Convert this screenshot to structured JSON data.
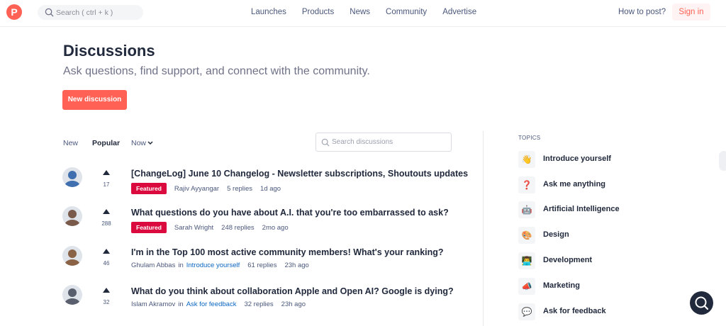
{
  "header": {
    "logo_letter": "P",
    "search_placeholder": "Search ( ctrl + k )",
    "nav": [
      "Launches",
      "Products",
      "News",
      "Community",
      "Advertise"
    ],
    "how_to_post": "How to post?",
    "sign_in": "Sign in"
  },
  "hero": {
    "title": "Discussions",
    "subtitle": "Ask questions, find support, and connect with the community.",
    "new_button": "New discussion"
  },
  "filters": {
    "new": "New",
    "popular": "Popular",
    "now": "Now",
    "search_placeholder": "Search discussions"
  },
  "discussions": [
    {
      "title": "[ChangeLog] June 10 Changelog - Newsletter subscriptions, Shoutouts updates",
      "votes": "17",
      "badge": "Featured",
      "author": "Rajiv Ayyangar",
      "topic_prefix": "",
      "topic": "",
      "replies": "5 replies",
      "time": "1d ago",
      "avatar_color": "#3f6fae"
    },
    {
      "title": "What questions do you have about A.I. that you're too embarrassed to ask?",
      "votes": "288",
      "badge": "Featured",
      "author": "Sarah Wright",
      "topic_prefix": "",
      "topic": "",
      "replies": "248 replies",
      "time": "2mo ago",
      "avatar_color": "#7a5a4a"
    },
    {
      "title": "I'm in the Top 100 most active community members! What's your ranking?",
      "votes": "46",
      "badge": "",
      "author": "Ghulam Abbas",
      "topic_prefix": "in",
      "topic": "Introduce yourself",
      "replies": "61 replies",
      "time": "23h ago",
      "avatar_color": "#8a6346"
    },
    {
      "title": "What do you think about collaboration Apple and Open AI? Google is dying?",
      "votes": "32",
      "badge": "",
      "author": "Islam Akramov",
      "topic_prefix": "in",
      "topic": "Ask for feedback",
      "replies": "32 replies",
      "time": "23h ago",
      "avatar_color": "#5a5f6e"
    }
  ],
  "topics": {
    "heading": "TOPICS",
    "items": [
      {
        "label": "Introduce yourself",
        "icon": "waving-hand-icon",
        "glyph": "👋"
      },
      {
        "label": "Ask me anything",
        "icon": "question-mark-icon",
        "glyph": "❓"
      },
      {
        "label": "Artificial Intelligence",
        "icon": "robot-icon",
        "glyph": "🤖"
      },
      {
        "label": "Design",
        "icon": "palette-icon",
        "glyph": "🎨"
      },
      {
        "label": "Development",
        "icon": "developer-icon",
        "glyph": "👨‍💻"
      },
      {
        "label": "Marketing",
        "icon": "megaphone-icon",
        "glyph": "📣"
      },
      {
        "label": "Ask for feedback",
        "icon": "speech-bubble-icon",
        "glyph": "💬"
      }
    ]
  },
  "colors": {
    "brand": "#ff6154",
    "featured": "#da0a3e",
    "link": "#0a66c2"
  }
}
